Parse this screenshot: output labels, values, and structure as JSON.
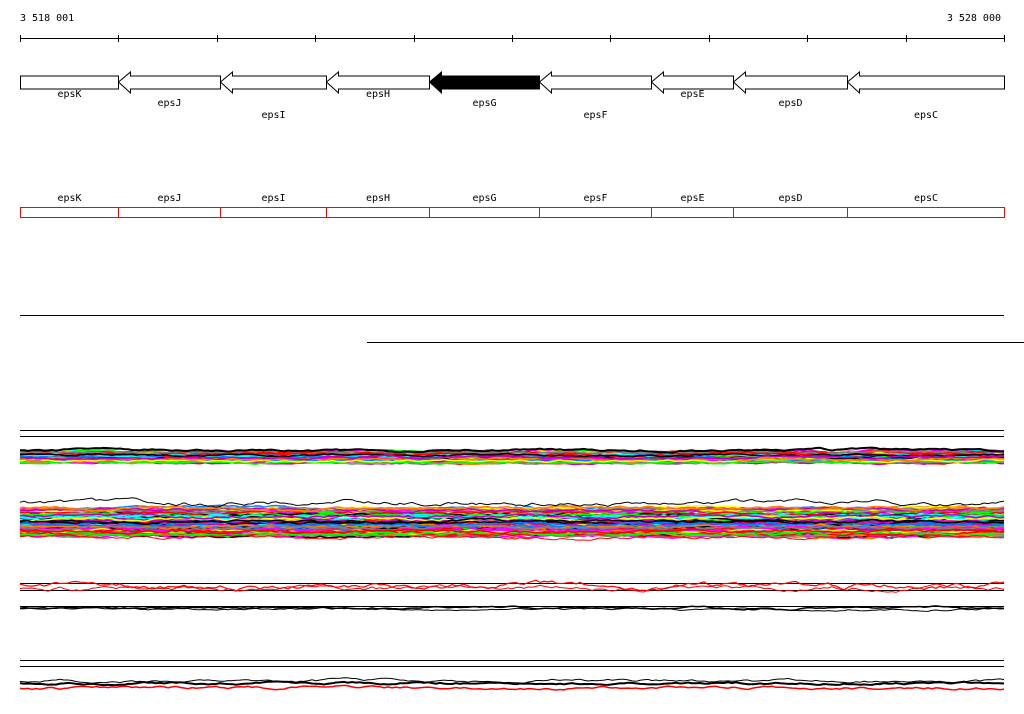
{
  "ruler": {
    "start_label": "3 518 001",
    "end_label": "3 528 000",
    "start": 3518001,
    "end": 3528000,
    "tick_count": 10
  },
  "genes": [
    {
      "name": "epsK",
      "start": 3518001,
      "end": 3519000,
      "strand": "none",
      "highlighted": false
    },
    {
      "name": "epsJ",
      "start": 3519000,
      "end": 3520030,
      "strand": "-",
      "highlighted": false
    },
    {
      "name": "epsI",
      "start": 3520030,
      "end": 3521110,
      "strand": "-",
      "highlighted": false
    },
    {
      "name": "epsH",
      "start": 3521110,
      "end": 3522160,
      "strand": "-",
      "highlighted": false
    },
    {
      "name": "epsG",
      "start": 3522160,
      "end": 3523270,
      "strand": "-",
      "highlighted": true
    },
    {
      "name": "epsF",
      "start": 3523270,
      "end": 3524410,
      "strand": "-",
      "highlighted": false
    },
    {
      "name": "epsE",
      "start": 3524410,
      "end": 3525250,
      "strand": "-",
      "highlighted": false
    },
    {
      "name": "epsD",
      "start": 3525250,
      "end": 3526400,
      "strand": "-",
      "highlighted": false
    },
    {
      "name": "epsC",
      "start": 3526400,
      "end": 3528000,
      "strand": "-",
      "highlighted": false
    }
  ],
  "colors": {
    "gene_fill": "#ffffff",
    "gene_highlight": "#000000",
    "feature_outline": "#ff0000",
    "profile_palette": [
      "#ff00ff",
      "#00ffff",
      "#0080ff",
      "#00ff00",
      "#ffff00",
      "#ff8000",
      "#808080",
      "#ff0000",
      "#000000",
      "#c000c0"
    ]
  }
}
